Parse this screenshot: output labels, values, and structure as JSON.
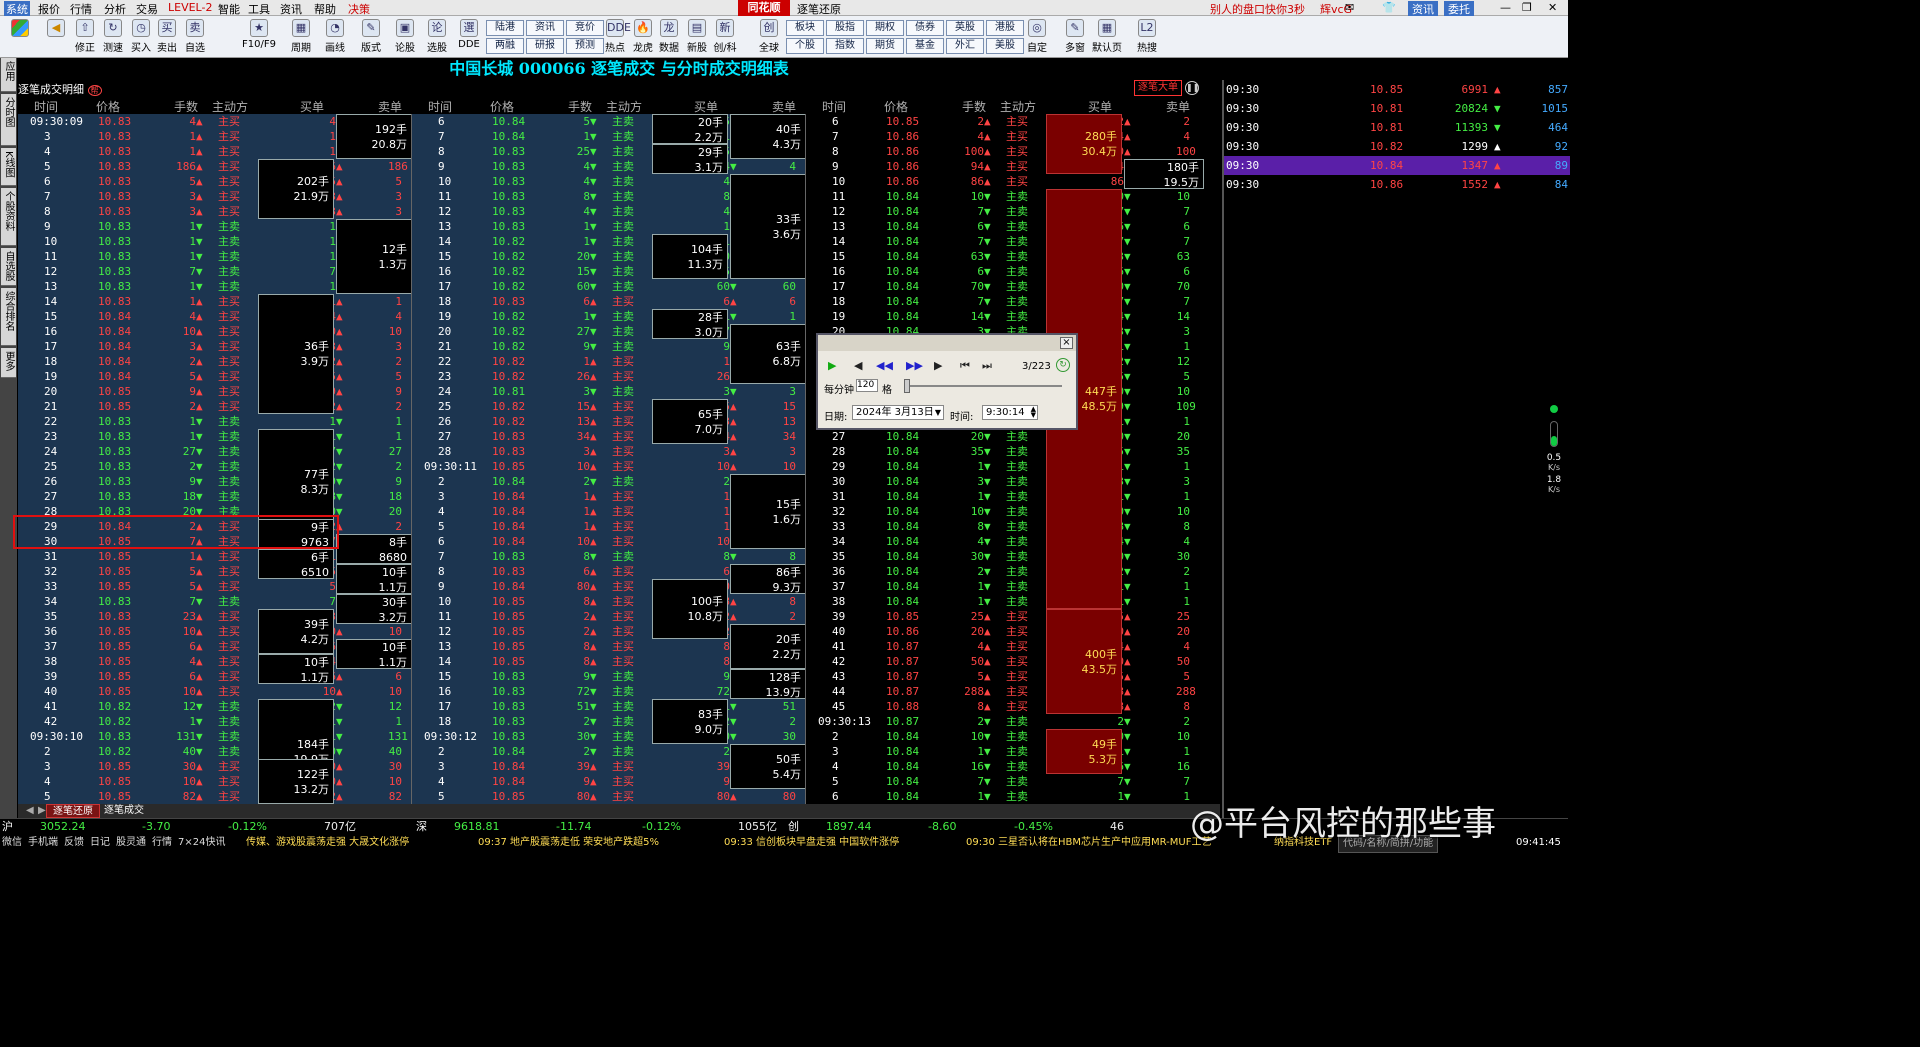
{
  "menu": [
    "系统",
    "报价",
    "行情",
    "分析",
    "交易",
    "智能",
    "工具",
    "资讯",
    "帮助",
    "决策"
  ],
  "menu_level2": "LEVEL-2",
  "brand": "同花顺",
  "window_title": "逐笔还原",
  "right_link": "别人的盘口快你3秒",
  "user_label": "辉vcG",
  "top_buttons": [
    "资讯",
    "委托"
  ],
  "toolbar_items": [
    "修正",
    "测速",
    "买入",
    "卖出",
    "自选",
    "F10/F9",
    "周期",
    "画线",
    "版式",
    "论股",
    "选股",
    "DDE",
    "热点",
    "龙虎",
    "数据",
    "新股",
    "创/科",
    "全球",
    "自定",
    "多窗",
    "默认页",
    "热搜"
  ],
  "toolbar_buttons": [
    "陆港",
    "两融",
    "资讯",
    "研报",
    "竞价",
    "预测",
    "板块",
    "个股",
    "股指",
    "指数",
    "期权",
    "期货",
    "债券",
    "基金",
    "英股",
    "外汇",
    "港股",
    "美股"
  ],
  "side_tabs": [
    "应用",
    "分时图",
    "K线图",
    "个股资料",
    "自选股",
    "综合排名",
    "更多"
  ],
  "main_title": "中国长城 000066 逐笔成交 与分时成交明细表",
  "sub_header": "逐笔成交明细",
  "big_order_badge": "逐笔大单",
  "columns": [
    "时间",
    "价格",
    "手数",
    "主动方",
    "买单",
    "卖单"
  ],
  "col1_rows": [
    [
      "09:30:09",
      "10.83",
      "4",
      "b"
    ],
    [
      "3",
      "10.83",
      "1",
      "b"
    ],
    [
      "4",
      "10.83",
      "1",
      "b"
    ],
    [
      "5",
      "10.83",
      "186",
      "b"
    ],
    [
      "6",
      "10.83",
      "5",
      "b"
    ],
    [
      "7",
      "10.83",
      "3",
      "b"
    ],
    [
      "8",
      "10.83",
      "3",
      "b"
    ],
    [
      "9",
      "10.83",
      "1",
      "s"
    ],
    [
      "10",
      "10.83",
      "1",
      "s"
    ],
    [
      "11",
      "10.83",
      "1",
      "s"
    ],
    [
      "12",
      "10.83",
      "7",
      "s"
    ],
    [
      "13",
      "10.83",
      "1",
      "s"
    ],
    [
      "14",
      "10.83",
      "1",
      "b"
    ],
    [
      "15",
      "10.84",
      "4",
      "b"
    ],
    [
      "16",
      "10.84",
      "10",
      "b"
    ],
    [
      "17",
      "10.84",
      "3",
      "b"
    ],
    [
      "18",
      "10.84",
      "2",
      "b"
    ],
    [
      "19",
      "10.84",
      "5",
      "b"
    ],
    [
      "20",
      "10.85",
      "9",
      "b"
    ],
    [
      "21",
      "10.85",
      "2",
      "b"
    ],
    [
      "22",
      "10.83",
      "1",
      "s"
    ],
    [
      "23",
      "10.83",
      "1",
      "s"
    ],
    [
      "24",
      "10.83",
      "27",
      "s"
    ],
    [
      "25",
      "10.83",
      "2",
      "s"
    ],
    [
      "26",
      "10.83",
      "9",
      "s"
    ],
    [
      "27",
      "10.83",
      "18",
      "s"
    ],
    [
      "28",
      "10.83",
      "20",
      "s"
    ],
    [
      "29",
      "10.84",
      "2",
      "b"
    ],
    [
      "30",
      "10.85",
      "7",
      "b"
    ],
    [
      "31",
      "10.85",
      "1",
      "b"
    ],
    [
      "32",
      "10.85",
      "5",
      "b"
    ],
    [
      "33",
      "10.85",
      "5",
      "b"
    ],
    [
      "34",
      "10.83",
      "7",
      "s"
    ],
    [
      "35",
      "10.83",
      "23",
      "b"
    ],
    [
      "36",
      "10.85",
      "10",
      "b"
    ],
    [
      "37",
      "10.85",
      "6",
      "b"
    ],
    [
      "38",
      "10.85",
      "4",
      "b"
    ],
    [
      "39",
      "10.85",
      "6",
      "b"
    ],
    [
      "40",
      "10.85",
      "10",
      "b"
    ],
    [
      "41",
      "10.82",
      "12",
      "s"
    ],
    [
      "42",
      "10.82",
      "1",
      "s"
    ],
    [
      "09:30:10",
      "10.83",
      "131",
      "s"
    ],
    [
      "2",
      "10.82",
      "40",
      "s"
    ],
    [
      "3",
      "10.85",
      "30",
      "b"
    ],
    [
      "4",
      "10.85",
      "10",
      "b"
    ],
    [
      "5",
      "10.85",
      "82",
      "b"
    ]
  ],
  "col1_buy_boxes": [
    [
      "202手",
      "21.9万"
    ],
    [
      "36手",
      "3.9万"
    ],
    [
      "77手",
      "8.3万"
    ],
    [
      "9手",
      "9763"
    ],
    [
      "6手",
      "6510"
    ],
    [
      "39手",
      "4.2万"
    ],
    [
      "10手",
      "1.1万"
    ],
    [
      "184手",
      "19.9万"
    ],
    [
      "122手",
      "13.2万"
    ]
  ],
  "col1_sell_boxes": [
    [
      "192手",
      "20.8万"
    ],
    [
      "12手",
      "1.3万"
    ],
    [
      "8手",
      "8680"
    ],
    [
      "10手",
      "1.1万"
    ],
    [
      "30手",
      "3.2万"
    ],
    [
      "10手",
      "1.1万"
    ]
  ],
  "col2_rows": [
    [
      "6",
      "10.84",
      "5",
      "s"
    ],
    [
      "7",
      "10.84",
      "1",
      "s"
    ],
    [
      "8",
      "10.83",
      "25",
      "s"
    ],
    [
      "9",
      "10.83",
      "4",
      "s"
    ],
    [
      "10",
      "10.83",
      "4",
      "s"
    ],
    [
      "11",
      "10.83",
      "8",
      "s"
    ],
    [
      "12",
      "10.83",
      "4",
      "s"
    ],
    [
      "13",
      "10.83",
      "1",
      "s"
    ],
    [
      "14",
      "10.82",
      "1",
      "s"
    ],
    [
      "15",
      "10.82",
      "20",
      "s"
    ],
    [
      "16",
      "10.82",
      "15",
      "s"
    ],
    [
      "17",
      "10.82",
      "60",
      "s"
    ],
    [
      "18",
      "10.83",
      "6",
      "b"
    ],
    [
      "19",
      "10.82",
      "1",
      "s"
    ],
    [
      "20",
      "10.82",
      "27",
      "s"
    ],
    [
      "21",
      "10.82",
      "9",
      "s"
    ],
    [
      "22",
      "10.82",
      "1",
      "b"
    ],
    [
      "23",
      "10.82",
      "26",
      "b"
    ],
    [
      "24",
      "10.81",
      "3",
      "s"
    ],
    [
      "25",
      "10.82",
      "15",
      "b"
    ],
    [
      "26",
      "10.82",
      "13",
      "b"
    ],
    [
      "27",
      "10.83",
      "34",
      "b"
    ],
    [
      "28",
      "10.83",
      "3",
      "b"
    ],
    [
      "09:30:11",
      "10.85",
      "10",
      "b"
    ],
    [
      "2",
      "10.84",
      "2",
      "s"
    ],
    [
      "3",
      "10.84",
      "1",
      "b"
    ],
    [
      "4",
      "10.84",
      "1",
      "b"
    ],
    [
      "5",
      "10.84",
      "1",
      "b"
    ],
    [
      "6",
      "10.84",
      "10",
      "b"
    ],
    [
      "7",
      "10.83",
      "8",
      "s"
    ],
    [
      "8",
      "10.83",
      "6",
      "b"
    ],
    [
      "9",
      "10.84",
      "80",
      "b"
    ],
    [
      "10",
      "10.85",
      "8",
      "b"
    ],
    [
      "11",
      "10.85",
      "2",
      "b"
    ],
    [
      "12",
      "10.85",
      "2",
      "b"
    ],
    [
      "13",
      "10.85",
      "8",
      "b"
    ],
    [
      "14",
      "10.85",
      "8",
      "b"
    ],
    [
      "15",
      "10.83",
      "9",
      "s"
    ],
    [
      "16",
      "10.83",
      "72",
      "s"
    ],
    [
      "17",
      "10.83",
      "51",
      "s"
    ],
    [
      "18",
      "10.83",
      "2",
      "s"
    ],
    [
      "09:30:12",
      "10.83",
      "30",
      "s"
    ],
    [
      "2",
      "10.84",
      "2",
      "s"
    ],
    [
      "3",
      "10.84",
      "39",
      "b"
    ],
    [
      "4",
      "10.84",
      "9",
      "b"
    ],
    [
      "5",
      "10.85",
      "80",
      "b"
    ]
  ],
  "col2_buy_boxes": [
    [
      "20手",
      "2.2万"
    ],
    [
      "29手",
      "3.1万"
    ],
    [
      "104手",
      "11.3万"
    ],
    [
      "28手",
      "3.0万"
    ],
    [
      "65手",
      "7.0万"
    ],
    [
      "100手",
      "10.8万"
    ],
    [
      "83手",
      "9.0万"
    ]
  ],
  "col2_sell_boxes": [
    [
      "40手",
      "4.3万"
    ],
    [
      "33手",
      "3.6万"
    ],
    [
      "63手",
      "6.8万"
    ],
    [
      "15手",
      "1.6万"
    ],
    [
      "86手",
      "9.3万"
    ],
    [
      "20手",
      "2.2万"
    ],
    [
      "128手",
      "13.9万"
    ],
    [
      "50手",
      "5.4万"
    ]
  ],
  "col3_rows": [
    [
      "6",
      "10.85",
      "2",
      "b"
    ],
    [
      "7",
      "10.86",
      "4",
      "b"
    ],
    [
      "8",
      "10.86",
      "100",
      "b"
    ],
    [
      "9",
      "10.86",
      "94",
      "b"
    ],
    [
      "10",
      "10.86",
      "86",
      "b"
    ],
    [
      "11",
      "10.84",
      "10",
      "s"
    ],
    [
      "12",
      "10.84",
      "7",
      "s"
    ],
    [
      "13",
      "10.84",
      "6",
      "s"
    ],
    [
      "14",
      "10.84",
      "7",
      "s"
    ],
    [
      "15",
      "10.84",
      "63",
      "s"
    ],
    [
      "16",
      "10.84",
      "6",
      "s"
    ],
    [
      "17",
      "10.84",
      "70",
      "s"
    ],
    [
      "18",
      "10.84",
      "7",
      "s"
    ],
    [
      "19",
      "10.84",
      "14",
      "s"
    ],
    [
      "20",
      "10.84",
      "3",
      "s"
    ],
    [
      "21",
      "10.84",
      "1",
      "s"
    ],
    [
      "22",
      "10.84",
      "12",
      "s"
    ],
    [
      "23",
      "10.84",
      "5",
      "s"
    ],
    [
      "24",
      "10.84",
      "10",
      "s"
    ],
    [
      "25",
      "10.84",
      "109",
      "s"
    ],
    [
      "26",
      "10.84",
      "1",
      "s"
    ],
    [
      "27",
      "10.84",
      "20",
      "s"
    ],
    [
      "28",
      "10.84",
      "35",
      "s"
    ],
    [
      "29",
      "10.84",
      "1",
      "s"
    ],
    [
      "30",
      "10.84",
      "3",
      "s"
    ],
    [
      "31",
      "10.84",
      "1",
      "s"
    ],
    [
      "32",
      "10.84",
      "10",
      "s"
    ],
    [
      "33",
      "10.84",
      "8",
      "s"
    ],
    [
      "34",
      "10.84",
      "4",
      "s"
    ],
    [
      "35",
      "10.84",
      "30",
      "s"
    ],
    [
      "36",
      "10.84",
      "2",
      "s"
    ],
    [
      "37",
      "10.84",
      "1",
      "s"
    ],
    [
      "38",
      "10.84",
      "1",
      "s"
    ],
    [
      "39",
      "10.85",
      "25",
      "b"
    ],
    [
      "40",
      "10.86",
      "20",
      "b"
    ],
    [
      "41",
      "10.87",
      "4",
      "b"
    ],
    [
      "42",
      "10.87",
      "50",
      "b"
    ],
    [
      "43",
      "10.87",
      "5",
      "b"
    ],
    [
      "44",
      "10.87",
      "288",
      "b"
    ],
    [
      "45",
      "10.88",
      "8",
      "b"
    ],
    [
      "09:30:13",
      "10.87",
      "2",
      "s"
    ],
    [
      "2",
      "10.84",
      "10",
      "s"
    ],
    [
      "3",
      "10.84",
      "1",
      "s"
    ],
    [
      "4",
      "10.84",
      "16",
      "s"
    ],
    [
      "5",
      "10.84",
      "7",
      "s"
    ],
    [
      "6",
      "10.84",
      "1",
      "s"
    ]
  ],
  "col3_buy_boxes": [
    [
      "280手",
      "30.4万"
    ],
    [
      "447手",
      "48.5万"
    ],
    [
      "400手",
      "43.5万"
    ],
    [
      "49手",
      "5.3万"
    ]
  ],
  "col3_sell_boxes": [
    [
      "180手",
      "19.5万"
    ]
  ],
  "dir_buy": "主买",
  "dir_sell": "主卖",
  "right_rows": [
    [
      "09:30",
      "10.85",
      "6991",
      "b",
      "857"
    ],
    [
      "09:30",
      "10.81",
      "20824",
      "s",
      "1015"
    ],
    [
      "09:30",
      "10.81",
      "11393",
      "s",
      "464"
    ],
    [
      "09:30",
      "10.82",
      "1299",
      "n",
      "92"
    ],
    [
      "09:30",
      "10.84",
      "1347",
      "b",
      "89"
    ],
    [
      "09:30",
      "10.86",
      "1552",
      "b",
      "84"
    ]
  ],
  "replay": {
    "close": "×",
    "page": "3/223",
    "per_min_label": "每分钟",
    "per_min_value": "120",
    "grid_label": "格",
    "date_label": "日期:",
    "date_value": "2024年 3月13日",
    "time_label": "时间:",
    "time_value": "9:30:14"
  },
  "speed": {
    "up": "0.5",
    "up_unit": "K/s",
    "down": "1.8",
    "down_unit": "K/s"
  },
  "bottom_tabs": [
    "逐笔还原",
    "逐笔成交"
  ],
  "index_bar": [
    {
      "name": "沪",
      "value": "3052.24",
      "change": "-3.70",
      "pct": "-0.12%",
      "amount": "707亿"
    },
    {
      "name": "深",
      "value": "9618.81",
      "change": "-11.74",
      "pct": "-0.12%",
      "amount": "1055亿"
    },
    {
      "name": "创",
      "value": "1897.44",
      "change": "-8.60",
      "pct": "-0.45%",
      "amount": "46"
    }
  ],
  "status_items": [
    "微信",
    "手机端",
    "反馈",
    "日记",
    "股灵通",
    "行情",
    "7×24快讯"
  ],
  "news": [
    "传媒、游戏股震荡走强 大晟文化涨停",
    "09:37 地产股震荡走低 荣安地产跌超5%",
    "09:33 信创板块早盘走强 中国软件涨停",
    "09:30 三星否认将在HBM芯片生产中应用MR-MUF工艺",
    "纳指科技ETF"
  ],
  "search_hint": "代码/名称/简拼/功能",
  "clock": "09:41:45",
  "watermark": "@平台风控的那些事"
}
